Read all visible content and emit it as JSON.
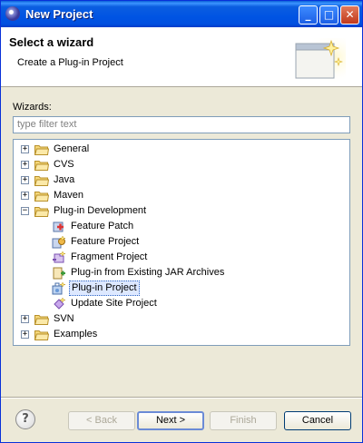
{
  "window": {
    "title": "New Project",
    "minimize": "_",
    "maximize": "□",
    "close": "✕"
  },
  "header": {
    "title": "Select a wizard",
    "description": "Create a Plug-in Project"
  },
  "wizards_label": "Wizards:",
  "filter": {
    "placeholder": "type filter text",
    "value": ""
  },
  "tree": {
    "items": [
      {
        "label": "General",
        "type": "folder",
        "expander": "+"
      },
      {
        "label": "CVS",
        "type": "folder",
        "expander": "+"
      },
      {
        "label": "Java",
        "type": "folder",
        "expander": "+"
      },
      {
        "label": "Maven",
        "type": "folder",
        "expander": "+"
      },
      {
        "label": "Plug-in Development",
        "type": "folder",
        "expander": "−"
      },
      {
        "label": "Feature Patch",
        "type": "wizard",
        "icon": "feature-patch-icon"
      },
      {
        "label": "Feature Project",
        "type": "wizard",
        "icon": "feature-project-icon"
      },
      {
        "label": "Fragment Project",
        "type": "wizard",
        "icon": "fragment-project-icon"
      },
      {
        "label": "Plug-in from Existing JAR Archives",
        "type": "wizard",
        "icon": "plugin-jar-icon"
      },
      {
        "label": "Plug-in Project",
        "type": "wizard",
        "icon": "plugin-project-icon",
        "selected": true
      },
      {
        "label": "Update Site Project",
        "type": "wizard",
        "icon": "update-site-icon"
      },
      {
        "label": "SVN",
        "type": "folder",
        "expander": "+"
      },
      {
        "label": "Examples",
        "type": "folder",
        "expander": "+"
      }
    ]
  },
  "buttons": {
    "help": "?",
    "back": "< Back",
    "next": "Next >",
    "finish": "Finish",
    "cancel": "Cancel"
  },
  "colors": {
    "titlebar": "#0054e3",
    "selection": "#dde8ff",
    "folder": "#f5d77a"
  }
}
